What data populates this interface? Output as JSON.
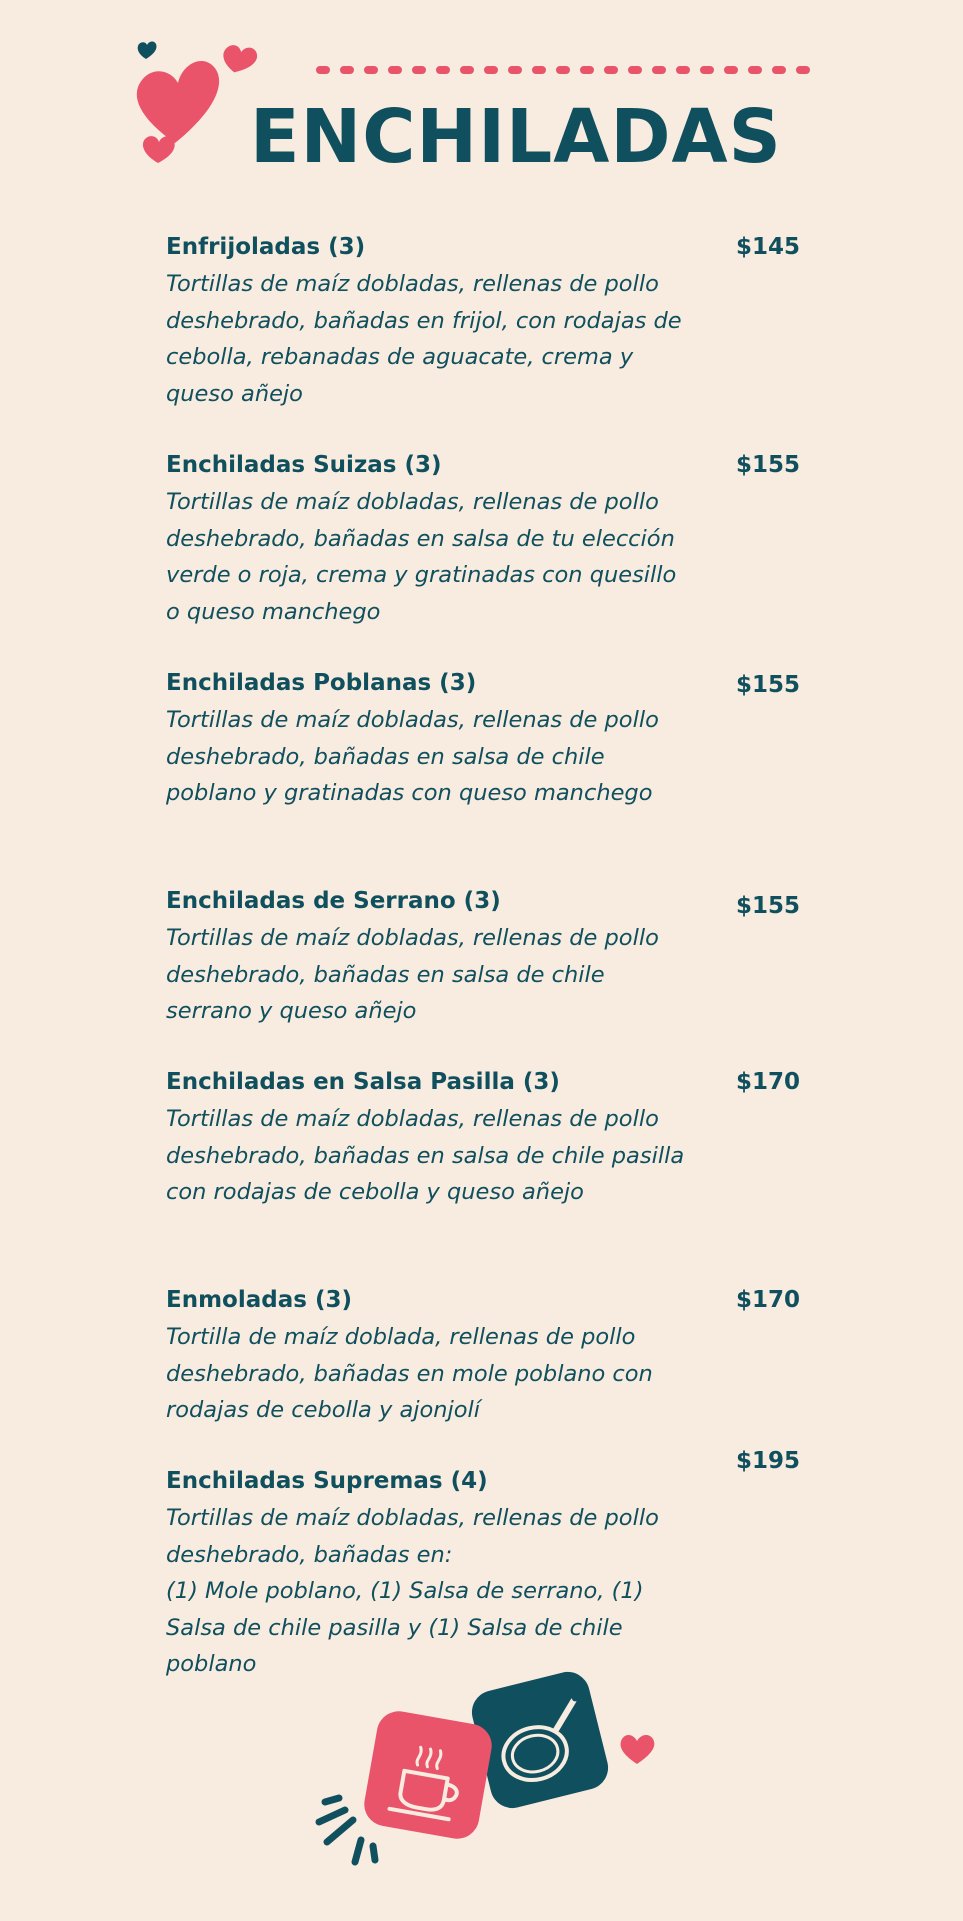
{
  "title": "ENCHILADAS",
  "colors": {
    "background": "#f8ebdf",
    "text": "#10505e",
    "accent_pink": "#e9546b",
    "accent_teal": "#10505e"
  },
  "items": [
    {
      "name": "Enfrijoladas (3)",
      "price": "$145",
      "desc": "Tortillas de maíz dobladas, rellenas de pollo deshebrado, bañadas en frijol, con rodajas de cebolla, rebanadas de aguacate, crema y queso añejo"
    },
    {
      "name": "Enchiladas Suizas (3)",
      "price": "$155",
      "desc": "Tortillas de maíz dobladas, rellenas de pollo deshebrado, bañadas en salsa de tu elección verde o roja, crema y gratinadas con quesillo o queso manchego"
    },
    {
      "name": "Enchiladas Poblanas (3)",
      "price": "$155",
      "desc": "Tortillas de maíz dobladas, rellenas de pollo deshebrado, bañadas en salsa de chile poblano y gratinadas con queso manchego"
    },
    {
      "name": "Enchiladas de Serrano (3)",
      "price": "$155",
      "desc": "Tortillas de maíz dobladas, rellenas de pollo deshebrado, bañadas en salsa de chile serrano y queso añejo"
    },
    {
      "name": "Enchiladas en Salsa Pasilla (3)",
      "price": "$170",
      "desc": "Tortillas de maíz dobladas, rellenas de pollo deshebrado, bañadas en salsa de chile pasilla con rodajas de cebolla y queso añejo"
    },
    {
      "name": "Enmoladas (3)",
      "price": "$170",
      "desc": "Tortilla de maíz doblada, rellenas de pollo deshebrado, bañadas en mole poblano  con rodajas de cebolla y ajonjolí"
    },
    {
      "name": "Enchiladas Supremas (4)",
      "price": "$195",
      "desc": "Tortillas de maíz dobladas, rellenas de pollo deshebrado, bañadas en:\n(1) Mole poblano, (1) Salsa de serrano, (1) Salsa de chile pasilla y (1) Salsa de chile poblano"
    }
  ],
  "icons": {
    "hearts": "hearts-cluster-icon",
    "coffee": "coffee-cup-icon",
    "pan": "frying-pan-icon",
    "heart": "heart-icon",
    "sparks": "spark-lines-icon"
  }
}
